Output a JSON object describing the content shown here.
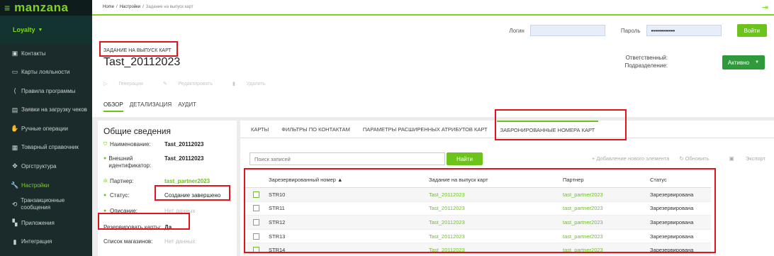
{
  "app": {
    "logo": "manzana"
  },
  "sidebar": {
    "section": "Loyalty",
    "items": [
      {
        "label": "Контакты",
        "icon": "contact-card-icon"
      },
      {
        "label": "Карты лояльности",
        "icon": "credit-card-icon"
      },
      {
        "label": "Правила программы",
        "icon": "rules-icon"
      },
      {
        "label": "Заявки на загрузку чеков",
        "icon": "receipt-icon"
      },
      {
        "label": "Ручные операции",
        "icon": "hand-icon"
      },
      {
        "label": "Товарный справочник",
        "icon": "catalog-icon"
      },
      {
        "label": "Оргструктура",
        "icon": "org-structure-icon"
      },
      {
        "label": "Настройки",
        "icon": "wrench-icon",
        "active": true
      },
      {
        "label": "Транзакционные сообщения",
        "icon": "messages-icon"
      },
      {
        "label": "Приложения",
        "icon": "apps-icon"
      },
      {
        "label": "Интеграция",
        "icon": "integration-icon"
      }
    ]
  },
  "breadcrumb": {
    "home": "Home",
    "settings": "Настройки",
    "current": "Задание на выпуск карт"
  },
  "auth": {
    "login_label": "Логин",
    "password_label": "Пароль",
    "password_value": "••••••••••••",
    "login_button": "Войти"
  },
  "header": {
    "task_label": "ЗАДАНИЕ НА ВЫПУСК КАРТ",
    "title": "Tast_20112023",
    "responsible_label": "Ответственный:",
    "department_label": "Подразделение:",
    "status_button": "Активно",
    "actions": {
      "generate": "Генерация",
      "edit": "Редактировать",
      "delete": "Удалить"
    },
    "subtabs": [
      "ОБЗОР",
      "ДЕТАЛИЗАЦИЯ",
      "АУДИТ"
    ]
  },
  "info": {
    "title": "Общие сведения",
    "name_k": "Наименование:",
    "name_v": "Tast_20112023",
    "ext_k": "Внешний идентификатор:",
    "ext_v": "Tast_20112023",
    "partner_k": "Партнер:",
    "partner_v": "tast_partner2023",
    "status_k": "Статус:",
    "status_v": "Создание завершено",
    "desc_k": "Описание:",
    "desc_v": "Нет данных",
    "reserve_k": "Резервировать карты:",
    "reserve_v": "Да",
    "shops_k": "Список магазинов:",
    "shops_v": "Нет данных"
  },
  "tabs": [
    "КАРТЫ",
    "ФИЛЬТРЫ ПО КОНТАКТАМ",
    "ПАРАМЕТРЫ РАСШИРЕННЫХ АТРИБУТОВ КАРТ",
    "ЗАБРОНИРОВАННЫЕ НОМЕРА КАРТ"
  ],
  "search": {
    "placeholder": "Поиск записей",
    "button": "Найти"
  },
  "tools": {
    "add": "+ Добавление нового элемента",
    "refresh": "↻ Обновить",
    "export": "Экспорт"
  },
  "grid": {
    "headers": [
      "Зарезервированный номер ▲",
      "Задание на выпуск карт",
      "Партнер",
      "Статус"
    ],
    "rows": [
      [
        "STR10",
        "Tast_20112023",
        "tast_partner2023",
        "Зарезервирована"
      ],
      [
        "STR11",
        "Tast_20112023",
        "tast_partner2023",
        "Зарезервирована"
      ],
      [
        "STR12",
        "Tast_20112023",
        "tast_partner2023",
        "Зарезервирована"
      ],
      [
        "STR13",
        "Tast_20112023",
        "tast_partner2023",
        "Зарезервирована"
      ],
      [
        "STR14",
        "Tast_20112023",
        "tast_partner2023",
        "Зарезервирована"
      ]
    ]
  }
}
